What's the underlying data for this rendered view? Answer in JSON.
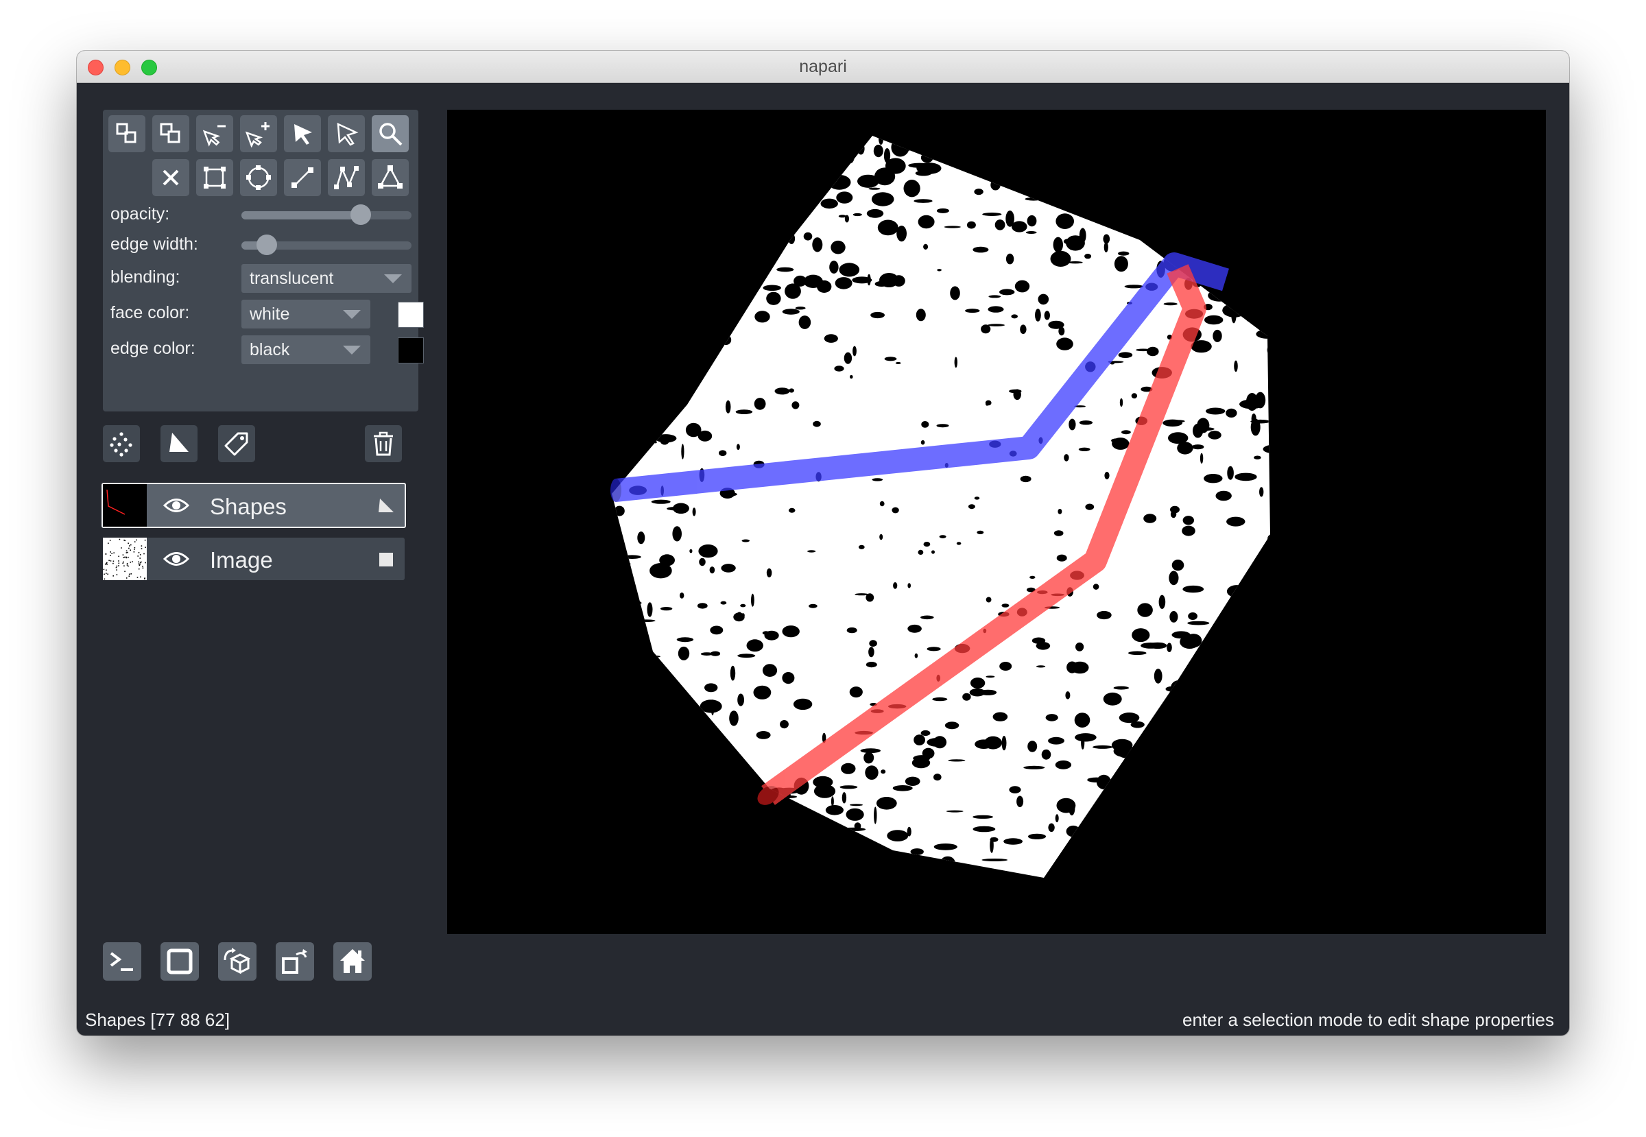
{
  "window": {
    "title": "napari"
  },
  "layer_controls": {
    "mode_buttons_row1": [
      "move-back-icon",
      "move-front-icon",
      "remove-vertex-icon",
      "add-vertex-icon",
      "select-icon",
      "direct-select-icon",
      "zoom-icon"
    ],
    "mode_buttons_row2": [
      "delete-shape-icon",
      "rectangle-icon",
      "ellipse-icon",
      "line-icon",
      "path-icon",
      "polygon-icon"
    ],
    "active_mode": "zoom-icon",
    "opacity_label": "opacity:",
    "opacity_value": 0.7,
    "edge_width_label": "edge width:",
    "edge_width_value": 0.15,
    "blending_label": "blending:",
    "blending_value": "translucent",
    "face_color_label": "face color:",
    "face_color_value": "white",
    "face_color_swatch": "#ffffff",
    "edge_color_label": "edge color:",
    "edge_color_value": "black",
    "edge_color_swatch": "#000000"
  },
  "layer_list": {
    "buttons": [
      "new-points-icon",
      "new-shapes-icon",
      "new-labels-icon",
      "delete-layer-icon"
    ],
    "layers": [
      {
        "name": "Shapes",
        "visible": true,
        "type_icon": "shapes-type-icon",
        "selected": true
      },
      {
        "name": "Image",
        "visible": true,
        "type_icon": "image-type-icon",
        "selected": false
      }
    ]
  },
  "viewer_buttons": [
    "console-icon",
    "ndisplay-icon",
    "roll-icon",
    "transpose-icon",
    "home-icon"
  ],
  "canvas": {
    "background": "#000000",
    "shapes": [
      {
        "name": "blue-path",
        "color": "#3c3cff"
      },
      {
        "name": "red-path",
        "color": "#ff3c3c"
      }
    ]
  },
  "status": {
    "left": "Shapes [77 88 62]",
    "right": "enter a selection mode to edit shape properties"
  }
}
